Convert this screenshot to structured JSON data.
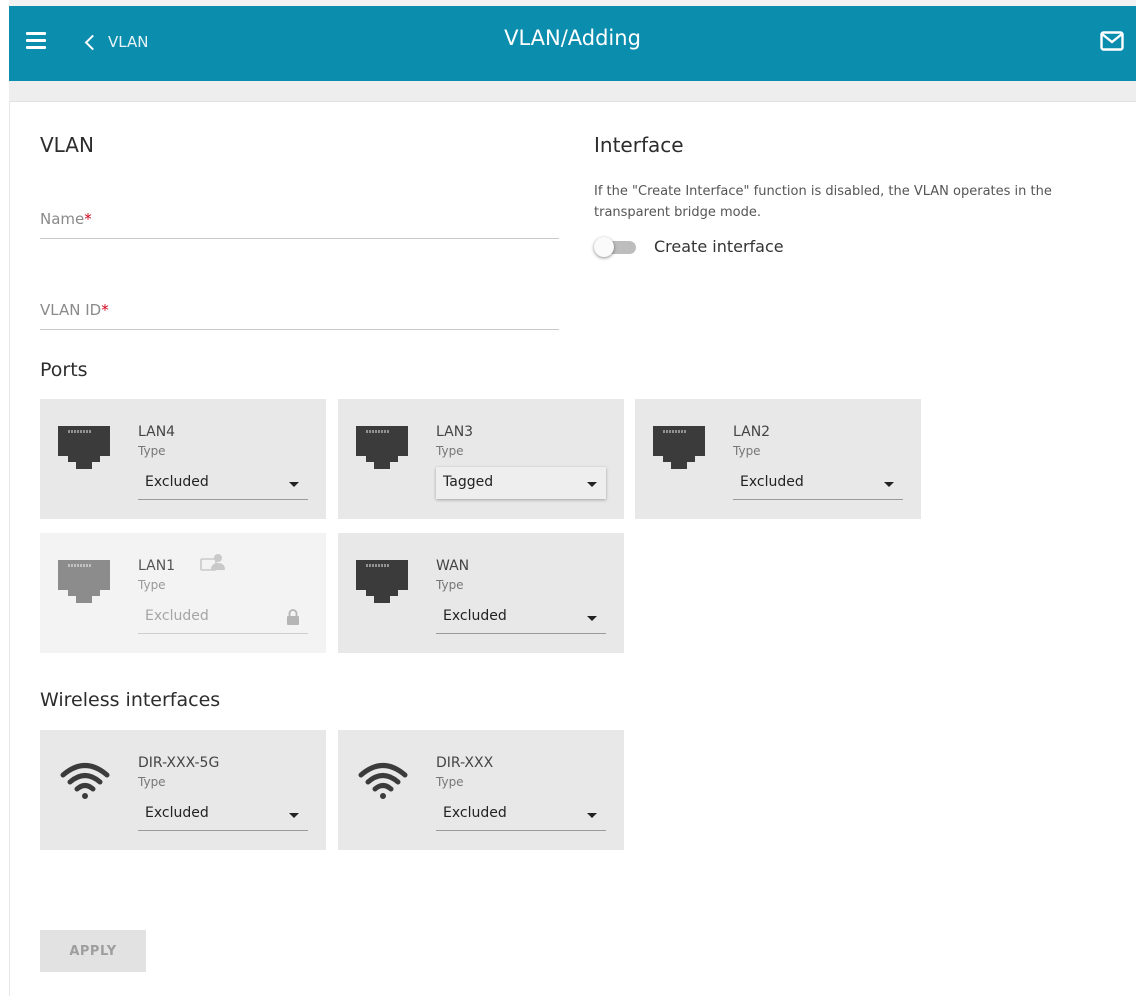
{
  "header": {
    "back_label": "VLAN",
    "title": "VLAN/Adding",
    "menu_icon": "hamburger-menu-icon",
    "mail_icon": "envelope-icon",
    "color": "#0b8dae"
  },
  "vlan_section": {
    "title": "VLAN",
    "name_field": {
      "label": "Name",
      "required_mark": "*",
      "value": ""
    },
    "vlan_id_field": {
      "label": "VLAN ID",
      "required_mark": "*",
      "value": ""
    }
  },
  "interface_section": {
    "title": "Interface",
    "description": "If the \"Create Interface\" function is disabled, the VLAN operates in the transparent bridge mode.",
    "toggle_label": "Create interface",
    "toggle_on": false
  },
  "ports": {
    "title": "Ports",
    "type_label": "Type",
    "items": [
      {
        "name": "LAN4",
        "type_label": "Type",
        "value": "Excluded",
        "disabled": false
      },
      {
        "name": "LAN3",
        "type_label": "Type",
        "value": "Tagged",
        "disabled": false
      },
      {
        "name": "LAN2",
        "type_label": "Type",
        "value": "Excluded",
        "disabled": false
      },
      {
        "name": "LAN1",
        "type_label": "Type",
        "value": "Excluded",
        "disabled": true
      },
      {
        "name": "WAN",
        "type_label": "Type",
        "value": "Excluded",
        "disabled": false
      }
    ]
  },
  "wireless": {
    "title": "Wireless interfaces",
    "items": [
      {
        "name": "DIR-XXX-5G",
        "type_label": "Type",
        "value": "Excluded"
      },
      {
        "name": "DIR-XXX",
        "type_label": "Type",
        "value": "Excluded"
      }
    ]
  },
  "apply_label": "APPLY"
}
